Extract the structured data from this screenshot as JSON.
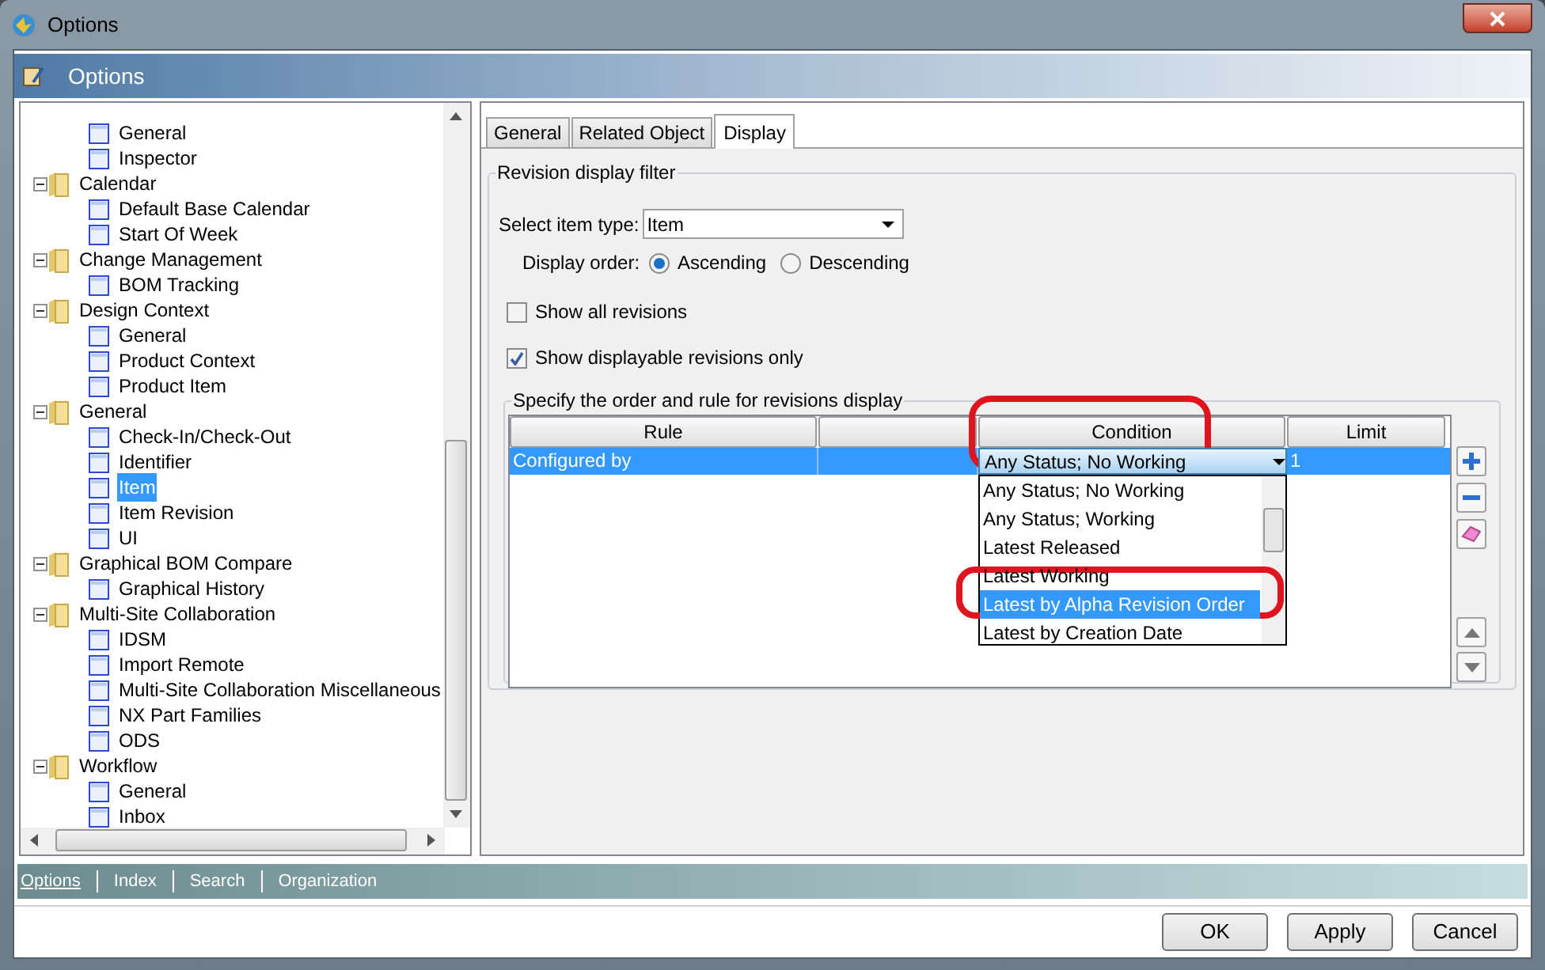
{
  "window": {
    "title": "Options"
  },
  "header": {
    "title": "Options"
  },
  "tree": [
    {
      "children": [
        {
          "label": "General",
          "selected": false
        },
        {
          "label": "Inspector",
          "selected": false
        }
      ]
    },
    {
      "label": "Calendar",
      "expanded": true,
      "selected": false,
      "children": [
        {
          "label": "Default Base Calendar",
          "selected": false
        },
        {
          "label": "Start Of Week",
          "selected": false
        }
      ]
    },
    {
      "label": "Change Management",
      "expanded": true,
      "selected": false,
      "children": [
        {
          "label": "BOM Tracking",
          "selected": false
        }
      ]
    },
    {
      "label": "Design Context",
      "expanded": true,
      "selected": false,
      "children": [
        {
          "label": "General",
          "selected": false
        },
        {
          "label": "Product Context",
          "selected": false
        },
        {
          "label": "Product Item",
          "selected": false
        }
      ]
    },
    {
      "label": "General",
      "expanded": true,
      "selected": false,
      "children": [
        {
          "label": "Check-In/Check-Out",
          "selected": false
        },
        {
          "label": "Identifier",
          "selected": false
        },
        {
          "label": "Item",
          "selected": true
        },
        {
          "label": "Item Revision",
          "selected": false
        },
        {
          "label": "UI",
          "selected": false
        }
      ]
    },
    {
      "label": "Graphical BOM Compare",
      "expanded": true,
      "selected": false,
      "children": [
        {
          "label": "Graphical History",
          "selected": false
        }
      ]
    },
    {
      "label": "Multi-Site Collaboration",
      "expanded": true,
      "selected": false,
      "children": [
        {
          "label": "IDSM",
          "selected": false
        },
        {
          "label": "Import Remote",
          "selected": false
        },
        {
          "label": "Multi-Site Collaboration Miscellaneous",
          "selected": false
        },
        {
          "label": "NX Part Families",
          "selected": false
        },
        {
          "label": "ODS",
          "selected": false
        }
      ]
    },
    {
      "label": "Workflow",
      "expanded": true,
      "selected": false,
      "children": [
        {
          "label": "General",
          "selected": false
        },
        {
          "label": "Inbox",
          "selected": false
        }
      ]
    }
  ],
  "tabs": [
    {
      "label": "General",
      "selected": false
    },
    {
      "label": "Related Object",
      "selected": false
    },
    {
      "label": "Display",
      "selected": true
    }
  ],
  "filter": {
    "title": "Revision display filter",
    "item_type": {
      "label": "Select item type:",
      "value": "Item"
    },
    "display_order": {
      "label": "Display order:",
      "options": [
        {
          "label": "Ascending",
          "selected": true
        },
        {
          "label": "Descending",
          "selected": false
        }
      ]
    },
    "checkboxes": [
      {
        "label": "Show all revisions",
        "checked": false
      },
      {
        "label": "Show displayable revisions only",
        "checked": true
      }
    ]
  },
  "rules": {
    "title": "Specify the order and rule for revisions display",
    "columns": [
      {
        "label": "Rule"
      },
      {},
      {
        "label": "Condition"
      },
      {
        "label": "Limit"
      }
    ],
    "rows": [
      {
        "rule": "Configured by",
        "condition": "Any Status; No Working",
        "limit": "1",
        "selected": true
      }
    ],
    "condition_options": [
      {
        "label": "Any Status; No Working",
        "selected": false
      },
      {
        "label": "Any Status; Working",
        "selected": false
      },
      {
        "label": "Latest Released",
        "selected": false
      },
      {
        "label": "Latest Working",
        "selected": false
      },
      {
        "label": "Latest by Alpha Revision Order",
        "selected": true
      },
      {
        "label": "Latest by Creation Date",
        "selected": false
      }
    ]
  },
  "nav": [
    {
      "label": "Options",
      "selected": true
    },
    {
      "label": "Index",
      "selected": false
    },
    {
      "label": "Search",
      "selected": false
    },
    {
      "label": "Organization",
      "selected": false
    }
  ],
  "buttons": [
    "OK",
    "Apply",
    "Cancel"
  ]
}
